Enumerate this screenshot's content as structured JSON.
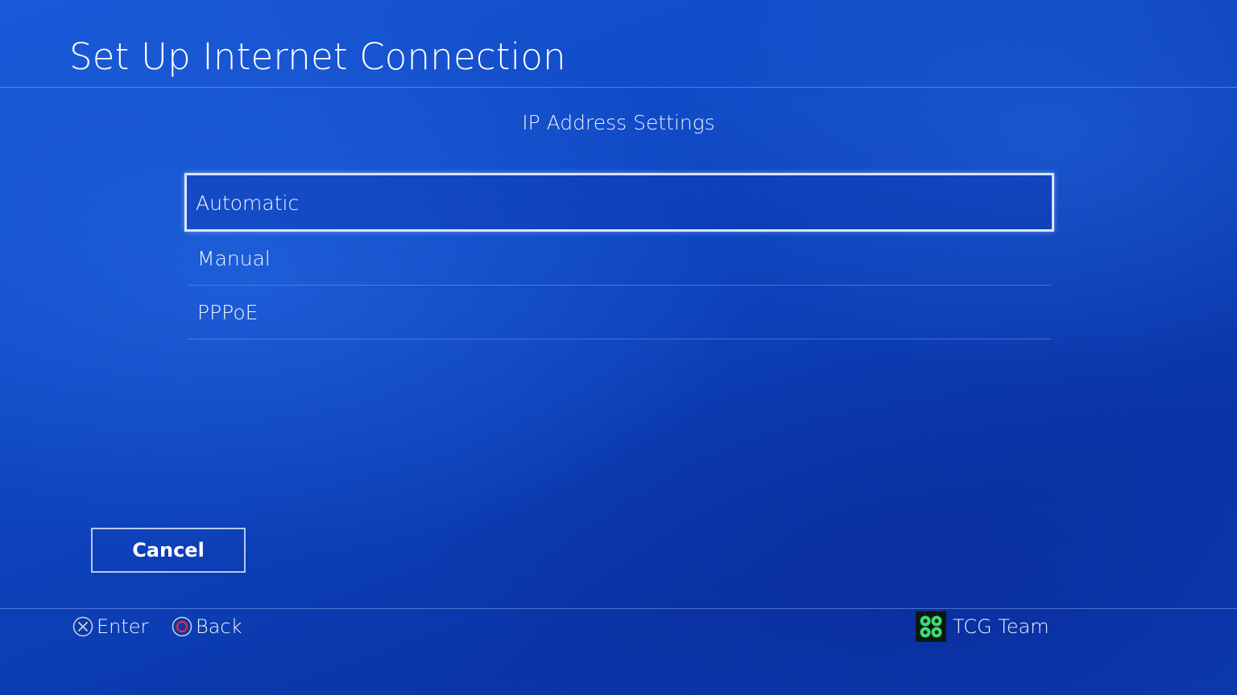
{
  "header": {
    "title": "Set Up Internet Connection"
  },
  "main": {
    "subtitle": "IP Address Settings",
    "options": [
      {
        "label": "Automatic",
        "selected": true
      },
      {
        "label": "Manual",
        "selected": false
      },
      {
        "label": "PPPoE",
        "selected": false
      }
    ],
    "cancel_label": "Cancel"
  },
  "footer": {
    "hints": [
      {
        "icon": "cross-button-icon",
        "label": "Enter"
      },
      {
        "icon": "circle-button-icon",
        "label": "Back"
      }
    ],
    "user": {
      "avatar_icon": "clover-avatar-icon",
      "name": "TCG Team"
    }
  },
  "colors": {
    "background": "#0e45c0",
    "selection_border": "#d9e4ff",
    "circle_button": "#e0303a",
    "avatar_accent": "#3ddc74"
  }
}
